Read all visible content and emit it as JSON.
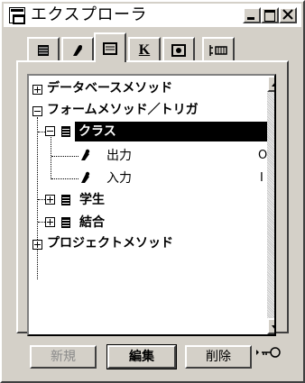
{
  "window": {
    "title": "エクスプローラ"
  },
  "tabs": [
    {
      "name": "table-tab-icon"
    },
    {
      "name": "method-tab-icon"
    },
    {
      "name": "form-tab-icon"
    },
    {
      "name": "constant-tab-icon",
      "label": "K"
    },
    {
      "name": "picture-tab-icon"
    },
    {
      "name": "structure-tab-icon"
    }
  ],
  "tree": {
    "items": [
      {
        "label": "データベースメソッド",
        "expander": "+"
      },
      {
        "label": "フォームメソッド／トリガ",
        "expander": "-"
      },
      {
        "label": "クラス",
        "expander": "-",
        "selected": true
      },
      {
        "label": "出力",
        "type": "O"
      },
      {
        "label": "入力",
        "type": "I"
      },
      {
        "label": "学生",
        "expander": "+"
      },
      {
        "label": "結合",
        "expander": "+"
      },
      {
        "label": "プロジェクトメソッド",
        "expander": "+"
      }
    ]
  },
  "buttons": {
    "new": "新規",
    "edit": "編集",
    "delete": "削除"
  },
  "icons": {
    "footer": "key-icon"
  }
}
